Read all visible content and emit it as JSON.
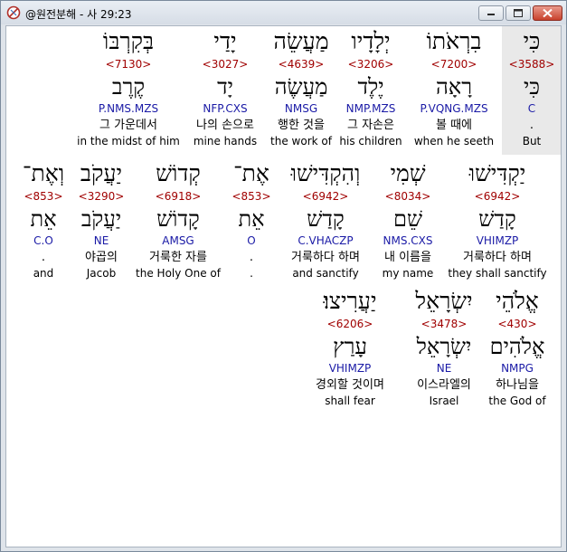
{
  "window": {
    "title": "@원전분해 - 사 29:23",
    "minimize_glyph": "▭",
    "maximize_glyph": "▣",
    "close_glyph": "✕"
  },
  "rows": [
    {
      "words": [
        {
          "hebrew": "כִּי",
          "strong": "<3588>",
          "lemma": "כִּי",
          "code": "C",
          "korean": ".",
          "english": "But",
          "selected": true
        },
        {
          "hebrew": "בִרְאֹתוֹ",
          "strong": "<7200>",
          "lemma": "רָאָה",
          "code": "P.VQNG.MZS",
          "korean": "볼 때에",
          "english": "when he seeth"
        },
        {
          "hebrew": "יְלָדָיו",
          "strong": "<3206>",
          "lemma": "יֶלֶד",
          "code": "NMP.MZS",
          "korean": "그 자손은",
          "english": "his children"
        },
        {
          "hebrew": "מַעֲשֵׂה",
          "strong": "<4639>",
          "lemma": "מַעֲשֶׂה",
          "code": "NMSG",
          "korean": "행한 것을",
          "english": "the work of"
        },
        {
          "hebrew": "יָדַי",
          "strong": "<3027>",
          "lemma": "יָד",
          "code": "NFP.CXS",
          "korean": "나의 손으로",
          "english": "mine hands"
        },
        {
          "hebrew": "בְּקִרְבּוֹ",
          "strong": "<7130>",
          "lemma": "קֶרֶב",
          "code": "P.NMS.MZS",
          "korean": "그 가운데서",
          "english": "in the midst of him"
        }
      ]
    },
    {
      "words": [
        {
          "hebrew": "יַקְדִּישׁוּ",
          "strong": "<6942>",
          "lemma": "קָדַשׁ",
          "code": "VHIMZP",
          "korean": "거룩하다 하며",
          "english": "they shall sanctify"
        },
        {
          "hebrew": "שְׁמִי",
          "strong": "<8034>",
          "lemma": "שֵׁם",
          "code": "NMS.CXS",
          "korean": "내 이름을",
          "english": "my name"
        },
        {
          "hebrew": "וְהִקְדִּישׁוּ",
          "strong": "<6942>",
          "lemma": "קָדַשׁ",
          "code": "C.VHACZP",
          "korean": "거룩하다 하며",
          "english": "and sanctify"
        },
        {
          "hebrew": "אֶת־",
          "strong": "<853>",
          "lemma": "אֵת",
          "code": "O",
          "korean": ".",
          "english": "."
        },
        {
          "hebrew": "קְדוֹשׁ",
          "strong": "<6918>",
          "lemma": "קָדוֹשׁ",
          "code": "AMSG",
          "korean": "거룩한 자를",
          "english": "the Holy One of"
        },
        {
          "hebrew": "יַעֲקֹב",
          "strong": "<3290>",
          "lemma": "יַעֲקֹב",
          "code": "NE",
          "korean": "야곱의",
          "english": "Jacob"
        },
        {
          "hebrew": "וְאֶת־",
          "strong": "<853>",
          "lemma": "אֵת",
          "code": "C.O",
          "korean": ".",
          "english": "and"
        }
      ]
    },
    {
      "words": [
        {
          "hebrew": "אֱלֹהֵי",
          "strong": "<430>",
          "lemma": "אֱלֹהִים",
          "code": "NMPG",
          "korean": "하나님을",
          "english": "the God of"
        },
        {
          "hebrew": "יִשְׂרָאֵל",
          "strong": "<3478>",
          "lemma": "יִשְׂרָאֵל",
          "code": "NE",
          "korean": "이스라엘의",
          "english": "Israel"
        },
        {
          "hebrew": "יַעֲרִיצוּ׃",
          "strong": "<6206>",
          "lemma": "עָרַץ",
          "code": "VHIMZP",
          "korean": "경외할 것이며",
          "english": "shall fear"
        }
      ]
    }
  ]
}
